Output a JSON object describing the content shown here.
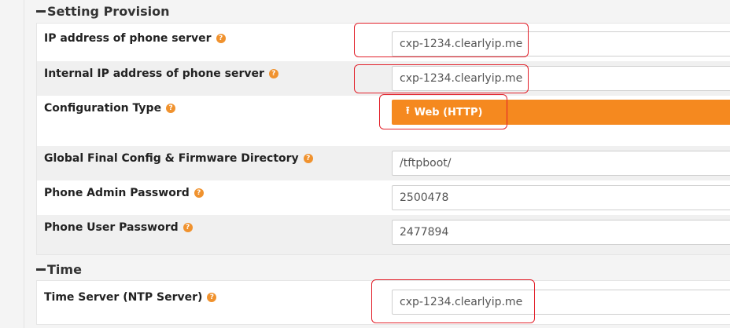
{
  "setting_provision": {
    "title": "Setting Provision",
    "rows": [
      {
        "label": "IP address of phone server",
        "value": "cxp-1234.clearlyip.me"
      },
      {
        "label": "Internal IP address of phone server",
        "value": "cxp-1234.clearlyip.me"
      },
      {
        "label": "Configuration Type",
        "button_label": "Web (HTTP)"
      },
      {
        "label": "Global Final Config & Firmware Directory",
        "value": "/tftpboot/"
      },
      {
        "label": "Phone Admin Password",
        "value": "2500478"
      },
      {
        "label": "Phone User Password",
        "value": "2477894"
      }
    ]
  },
  "time": {
    "title": "Time",
    "rows": [
      {
        "label": "Time Server (NTP Server)",
        "value": "cxp-1234.clearlyip.me"
      }
    ]
  },
  "help_glyph": "?",
  "icons": {
    "help": "question-circle-icon",
    "upload": "upload-icon",
    "collapse": "minus-icon"
  },
  "colors": {
    "accent": "#f5891f",
    "help_badge": "#f0922e",
    "annotation": "#e2202a"
  }
}
